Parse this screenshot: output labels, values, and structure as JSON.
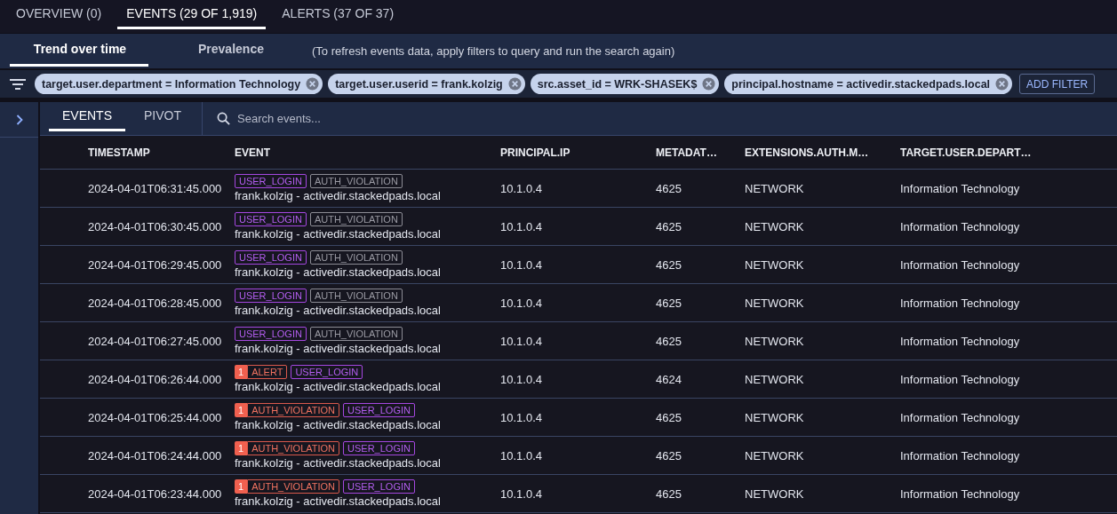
{
  "top_tabs": [
    {
      "label": "OVERVIEW (0)",
      "selected": false
    },
    {
      "label": "EVENTS (29 OF 1,919)",
      "selected": true
    },
    {
      "label": "ALERTS (37 OF 37)",
      "selected": false
    }
  ],
  "sub_tabs": [
    {
      "label": "Trend over time",
      "selected": true
    },
    {
      "label": "Prevalence",
      "selected": false
    }
  ],
  "hint": "(To refresh events data, apply filters to query and run the search again)",
  "filters": [
    "target.user.department = Information Technology",
    "target.user.userid = frank.kolzig",
    "src.asset_id = WRK-SHASEK$",
    "principal.hostname = activedir.stackedpads.local"
  ],
  "add_filter": "ADD FILTER",
  "panel_tabs": [
    {
      "label": "EVENTS",
      "selected": true
    },
    {
      "label": "PIVOT",
      "selected": false
    }
  ],
  "search": {
    "placeholder": "Search events..."
  },
  "table": {
    "columns": [
      "TIMESTAMP",
      "EVENT",
      "PRINCIPAL.IP",
      "METADAT…",
      "EXTENSIONS.AUTH.M…",
      "TARGET.USER.DEPART…"
    ],
    "rows": [
      {
        "timestamp": "2024-04-01T06:31:45.000",
        "tags": [
          {
            "kind": "primary",
            "label": "USER_LOGIN"
          },
          {
            "kind": "secondary",
            "label": "AUTH_VIOLATION"
          }
        ],
        "event": "frank.kolzig - activedir.stackedpads.local",
        "ip": "10.1.0.4",
        "metadata": "4625",
        "auth": "NETWORK",
        "department": "Information Technology"
      },
      {
        "timestamp": "2024-04-01T06:30:45.000",
        "tags": [
          {
            "kind": "primary",
            "label": "USER_LOGIN"
          },
          {
            "kind": "secondary",
            "label": "AUTH_VIOLATION"
          }
        ],
        "event": "frank.kolzig - activedir.stackedpads.local",
        "ip": "10.1.0.4",
        "metadata": "4625",
        "auth": "NETWORK",
        "department": "Information Technology"
      },
      {
        "timestamp": "2024-04-01T06:29:45.000",
        "tags": [
          {
            "kind": "primary",
            "label": "USER_LOGIN"
          },
          {
            "kind": "secondary",
            "label": "AUTH_VIOLATION"
          }
        ],
        "event": "frank.kolzig - activedir.stackedpads.local",
        "ip": "10.1.0.4",
        "metadata": "4625",
        "auth": "NETWORK",
        "department": "Information Technology"
      },
      {
        "timestamp": "2024-04-01T06:28:45.000",
        "tags": [
          {
            "kind": "primary",
            "label": "USER_LOGIN"
          },
          {
            "kind": "secondary",
            "label": "AUTH_VIOLATION"
          }
        ],
        "event": "frank.kolzig - activedir.stackedpads.local",
        "ip": "10.1.0.4",
        "metadata": "4625",
        "auth": "NETWORK",
        "department": "Information Technology"
      },
      {
        "timestamp": "2024-04-01T06:27:45.000",
        "tags": [
          {
            "kind": "primary",
            "label": "USER_LOGIN"
          },
          {
            "kind": "secondary",
            "label": "AUTH_VIOLATION"
          }
        ],
        "event": "frank.kolzig - activedir.stackedpads.local",
        "ip": "10.1.0.4",
        "metadata": "4625",
        "auth": "NETWORK",
        "department": "Information Technology"
      },
      {
        "timestamp": "2024-04-01T06:26:44.000",
        "tags": [
          {
            "kind": "alert",
            "count": "1",
            "label": "ALERT"
          },
          {
            "kind": "primary",
            "label": "USER_LOGIN"
          }
        ],
        "event": "frank.kolzig - activedir.stackedpads.local",
        "ip": "10.1.0.4",
        "metadata": "4624",
        "auth": "NETWORK",
        "department": "Information Technology"
      },
      {
        "timestamp": "2024-04-01T06:25:44.000",
        "tags": [
          {
            "kind": "alert",
            "count": "1",
            "label": "AUTH_VIOLATION"
          },
          {
            "kind": "primary",
            "label": "USER_LOGIN"
          }
        ],
        "event": "frank.kolzig - activedir.stackedpads.local",
        "ip": "10.1.0.4",
        "metadata": "4625",
        "auth": "NETWORK",
        "department": "Information Technology"
      },
      {
        "timestamp": "2024-04-01T06:24:44.000",
        "tags": [
          {
            "kind": "alert",
            "count": "1",
            "label": "AUTH_VIOLATION"
          },
          {
            "kind": "primary",
            "label": "USER_LOGIN"
          }
        ],
        "event": "frank.kolzig - activedir.stackedpads.local",
        "ip": "10.1.0.4",
        "metadata": "4625",
        "auth": "NETWORK",
        "department": "Information Technology"
      },
      {
        "timestamp": "2024-04-01T06:23:44.000",
        "tags": [
          {
            "kind": "alert",
            "count": "1",
            "label": "AUTH_VIOLATION"
          },
          {
            "kind": "primary",
            "label": "USER_LOGIN"
          }
        ],
        "event": "frank.kolzig - activedir.stackedpads.local",
        "ip": "10.1.0.4",
        "metadata": "4625",
        "auth": "NETWORK",
        "department": "Information Technology"
      }
    ]
  }
}
